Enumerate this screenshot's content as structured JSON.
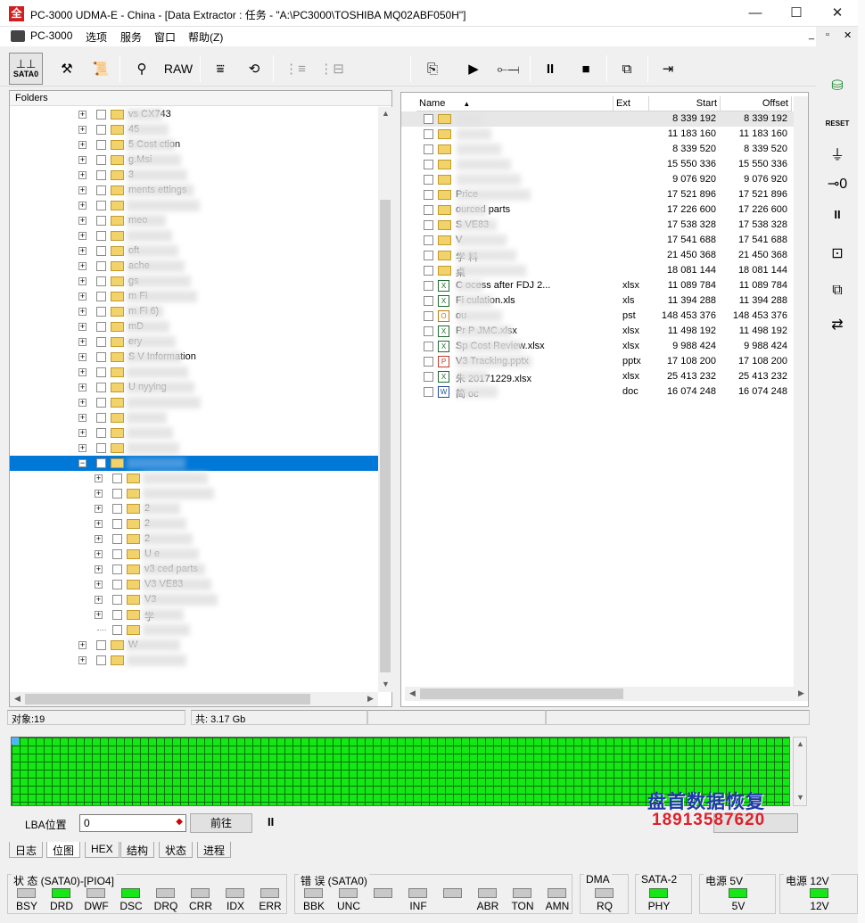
{
  "window": {
    "title": "PC-3000 UDMA-E - China - [Data Extractor : 任务 - \"A:\\PC3000\\TOSHIBA MQ02ABF050H\"]",
    "icon_text": "全",
    "minimize": "—",
    "maximize": "☐",
    "close": "✕"
  },
  "menu": {
    "items": [
      "PC-3000",
      "选项",
      "服务",
      "窗口",
      "帮助(Z)"
    ],
    "child_controls": [
      "_",
      "▫",
      "✕"
    ]
  },
  "toolbar": {
    "sata_label": "SATA0",
    "raw_label": "RAW"
  },
  "folders": {
    "header": "Folders",
    "rows": [
      {
        "label": "vs CX743",
        "expander": "+"
      },
      {
        "label": "45",
        "expander": "+"
      },
      {
        "label": "5 Cost          ction",
        "expander": "+"
      },
      {
        "label": "g.Msi",
        "expander": "+"
      },
      {
        "label": "3",
        "expander": "+"
      },
      {
        "label": "ments        ettings",
        "expander": "+"
      },
      {
        "label": "",
        "expander": "+"
      },
      {
        "label": "meo",
        "expander": "+"
      },
      {
        "label": "",
        "expander": "+"
      },
      {
        "label": "oft",
        "expander": "+"
      },
      {
        "label": "ache",
        "expander": "+"
      },
      {
        "label": "gs",
        "expander": "+"
      },
      {
        "label": "m Fi",
        "expander": "+"
      },
      {
        "label": "m Fi           6)",
        "expander": "+"
      },
      {
        "label": "mD",
        "expander": "+"
      },
      {
        "label": "ery",
        "expander": "+"
      },
      {
        "label": "S       V          Information",
        "expander": "+"
      },
      {
        "label": "",
        "expander": "+"
      },
      {
        "label": "U          nyying",
        "expander": "+"
      },
      {
        "label": "",
        "expander": "+"
      },
      {
        "label": "",
        "expander": "+"
      },
      {
        "label": "",
        "expander": "+"
      },
      {
        "label": "",
        "expander": "+"
      },
      {
        "label": "",
        "expander": "−",
        "selected": true
      },
      {
        "label": "",
        "expander": "+",
        "child": true
      },
      {
        "label": "",
        "expander": "+",
        "child": true
      },
      {
        "label": "2",
        "expander": "+",
        "child": true
      },
      {
        "label": "2",
        "expander": "+",
        "child": true
      },
      {
        "label": "2",
        "expander": "+",
        "child": true
      },
      {
        "label": "U          e",
        "expander": "+",
        "child": true
      },
      {
        "label": "v3          ced parts",
        "expander": "+",
        "child": true
      },
      {
        "label": "V3          VE83",
        "expander": "+",
        "child": true
      },
      {
        "label": "V3",
        "expander": "+",
        "child": true
      },
      {
        "label": "学",
        "expander": "+",
        "child": true
      },
      {
        "label": "",
        "expander": "",
        "child": true
      },
      {
        "label": "W",
        "expander": "+"
      },
      {
        "label": "",
        "expander": "+"
      }
    ]
  },
  "files": {
    "columns": {
      "name": "Name",
      "ext": "Ext",
      "start": "Start",
      "offset": "Offset"
    },
    "rows": [
      {
        "name": "",
        "ext": "",
        "start": "8 339 192",
        "offset": "8 339 192",
        "type": "folder"
      },
      {
        "name": "",
        "ext": "",
        "start": "11 183 160",
        "offset": "11 183 160",
        "type": "folder"
      },
      {
        "name": "",
        "ext": "",
        "start": "8 339 520",
        "offset": "8 339 520",
        "type": "folder"
      },
      {
        "name": "",
        "ext": "",
        "start": "15 550 336",
        "offset": "15 550 336",
        "type": "folder"
      },
      {
        "name": "",
        "ext": "",
        "start": "9 076 920",
        "offset": "9 076 920",
        "type": "folder"
      },
      {
        "name": "Price",
        "ext": "",
        "start": "17 521 896",
        "offset": "17 521 896",
        "type": "folder"
      },
      {
        "name": "ourced parts",
        "ext": "",
        "start": "17 226 600",
        "offset": "17 226 600",
        "type": "folder"
      },
      {
        "name": "S VE83",
        "ext": "",
        "start": "17 538 328",
        "offset": "17 538 328",
        "type": "folder"
      },
      {
        "name": "V",
        "ext": "",
        "start": "17 541 688",
        "offset": "17 541 688",
        "type": "folder"
      },
      {
        "name": "学          料",
        "ext": "",
        "start": "21 450 368",
        "offset": "21 450 368",
        "type": "folder"
      },
      {
        "name": "桌",
        "ext": "",
        "start": "18 081 144",
        "offset": "18 081 144",
        "type": "folder"
      },
      {
        "name": "C          ocess after FDJ 2...",
        "ext": "xlsx",
        "start": "11 089 784",
        "offset": "11 089 784",
        "type": "xls"
      },
      {
        "name": "Fi          culation.xls",
        "ext": "xls",
        "start": "11 394 288",
        "offset": "11 394 288",
        "type": "xls"
      },
      {
        "name": "ou",
        "ext": "pst",
        "start": "148 453 376",
        "offset": "148 453 376",
        "type": "pst"
      },
      {
        "name": "Pr          P JMC.xlsx",
        "ext": "xlsx",
        "start": "11 498 192",
        "offset": "11 498 192",
        "type": "xls"
      },
      {
        "name": "Sp          Cost Review.xlsx",
        "ext": "xlsx",
        "start": "9 988 424",
        "offset": "9 988 424",
        "type": "xls"
      },
      {
        "name": "V3          Tracking.pptx",
        "ext": "pptx",
        "start": "17 108 200",
        "offset": "17 108 200",
        "type": "ppt"
      },
      {
        "name": "朱          20171229.xlsx",
        "ext": "xlsx",
        "start": "25 413 232",
        "offset": "25 413 232",
        "type": "xls"
      },
      {
        "name": "简          oc",
        "ext": "doc",
        "start": "16 074 248",
        "offset": "16 074 248",
        "type": "doc"
      }
    ]
  },
  "status": {
    "objects": "对象:19",
    "total": "共:  3.17 Gb"
  },
  "lba": {
    "label": "LBA位置",
    "value": "0",
    "goto": "前往",
    "pause": "II"
  },
  "watermark": {
    "line1": "盘首数据恢复",
    "line2": "18913587620"
  },
  "tabs": [
    "日志",
    "位图",
    "HEX",
    "结构",
    "状态",
    "进程"
  ],
  "indicators": {
    "status_group": {
      "title": "状 态 (SATA0)-[PIO4]",
      "leds": [
        {
          "label": "BSY",
          "on": false
        },
        {
          "label": "DRD",
          "on": true
        },
        {
          "label": "DWF",
          "on": false
        },
        {
          "label": "DSC",
          "on": true
        },
        {
          "label": "DRQ",
          "on": false
        },
        {
          "label": "CRR",
          "on": false
        },
        {
          "label": "IDX",
          "on": false
        },
        {
          "label": "ERR",
          "on": false
        }
      ]
    },
    "error_group": {
      "title": "错 误 (SATA0)",
      "leds": [
        {
          "label": "BBK",
          "on": false
        },
        {
          "label": "UNC",
          "on": false
        },
        {
          "label": "",
          "on": false
        },
        {
          "label": "INF",
          "on": false
        },
        {
          "label": "",
          "on": false
        },
        {
          "label": "ABR",
          "on": false
        },
        {
          "label": "TON",
          "on": false
        },
        {
          "label": "AMN",
          "on": false
        }
      ]
    },
    "dma_group": {
      "title": "DMA",
      "leds": [
        {
          "label": "RQ",
          "on": false
        }
      ]
    },
    "sata_group": {
      "title": "SATA-2",
      "leds": [
        {
          "label": "PHY",
          "on": true
        }
      ]
    },
    "p5_group": {
      "title": "电源 5V",
      "leds": [
        {
          "label": "5V",
          "on": true
        }
      ]
    },
    "p12_group": {
      "title": "电源 12V",
      "leds": [
        {
          "label": "12V",
          "on": true
        }
      ]
    }
  },
  "colors": {
    "selection": "#0078d7",
    "led_on": "#19e619",
    "led_off": "#c8c8c8",
    "bitmap": "#14e814"
  }
}
